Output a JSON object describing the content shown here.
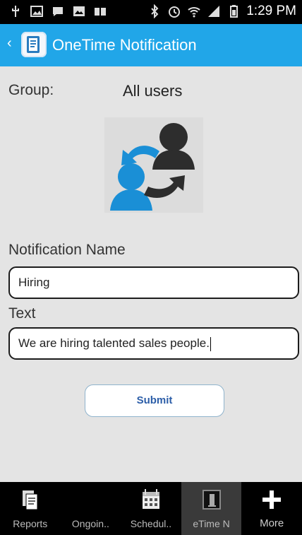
{
  "status_bar": {
    "time": "1:29 PM"
  },
  "app_bar": {
    "title": "OneTime Notification"
  },
  "form": {
    "group_label": "Group:",
    "group_value": "All users",
    "name_label": "Notification Name",
    "name_value": "Hiring",
    "text_label": "Text",
    "text_value": "We are hiring talented sales people.",
    "submit_label": "Submit"
  },
  "bottom_nav": [
    {
      "label": "Reports",
      "icon": "reports-icon"
    },
    {
      "label": "Ongoin..",
      "icon": "ongoing-icon"
    },
    {
      "label": "Schedul..",
      "icon": "calendar-icon"
    },
    {
      "label": "eTime N",
      "icon": "onetime-icon"
    },
    {
      "label": "More",
      "icon": "plus-icon"
    }
  ],
  "colors": {
    "accent": "#21a6e8",
    "background": "#e4e4e4"
  }
}
